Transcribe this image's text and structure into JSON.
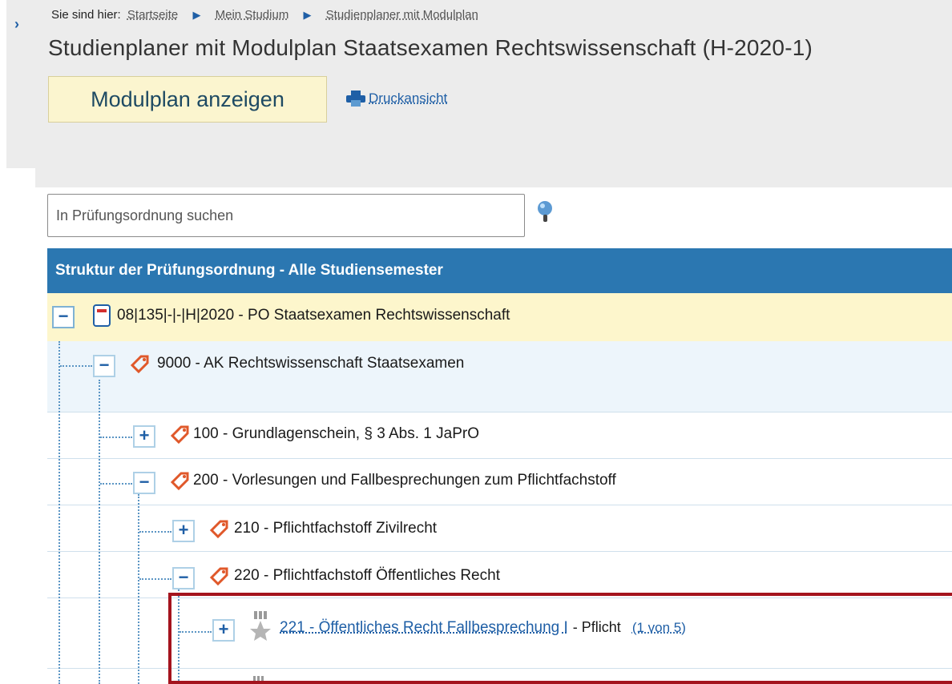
{
  "breadcrumb": {
    "prefix": "Sie sind hier:",
    "items": [
      "Startseite",
      "Mein Studium",
      "Studienplaner mit Modulplan"
    ]
  },
  "page": {
    "title": "Studienplaner mit Modulplan Staatsexamen Rechtswissenschaft (H-2020-1)"
  },
  "tabs": {
    "active_label": "Modulplan anzeigen",
    "print_label": "Druckansicht"
  },
  "search": {
    "placeholder": "In Prüfungsordnung suchen"
  },
  "tree": {
    "header": "Struktur der Prüfungsordnung - Alle Studiensemester",
    "rows": [
      {
        "toggle": "−",
        "label": "08|135|-|-|H|2020 - PO Staatsexamen Rechtswissenschaft"
      },
      {
        "toggle": "−",
        "label": "9000 - AK Rechtswissenschaft Staatsexamen"
      },
      {
        "toggle": "+",
        "label": "100 - Grundlagenschein, § 3 Abs. 1 JaPrO"
      },
      {
        "toggle": "−",
        "label": "200 - Vorlesungen und Fallbesprechungen zum Pflichtfachstoff"
      },
      {
        "toggle": "+",
        "label": "210 - Pflichtfachstoff Zivilrecht"
      },
      {
        "toggle": "−",
        "label": "220 - Pflichtfachstoff Öffentliches Recht"
      },
      {
        "toggle": "+",
        "label": "221 - Öffentliches Recht Fallbesprechung I",
        "suffix": "- Pflicht",
        "count": "(1 von 5)"
      }
    ]
  },
  "colors": {
    "header_bg": "#2b77b1",
    "root_bg": "#fdf6cc",
    "highlight": "#a4141e",
    "link": "#1f5fa6"
  }
}
